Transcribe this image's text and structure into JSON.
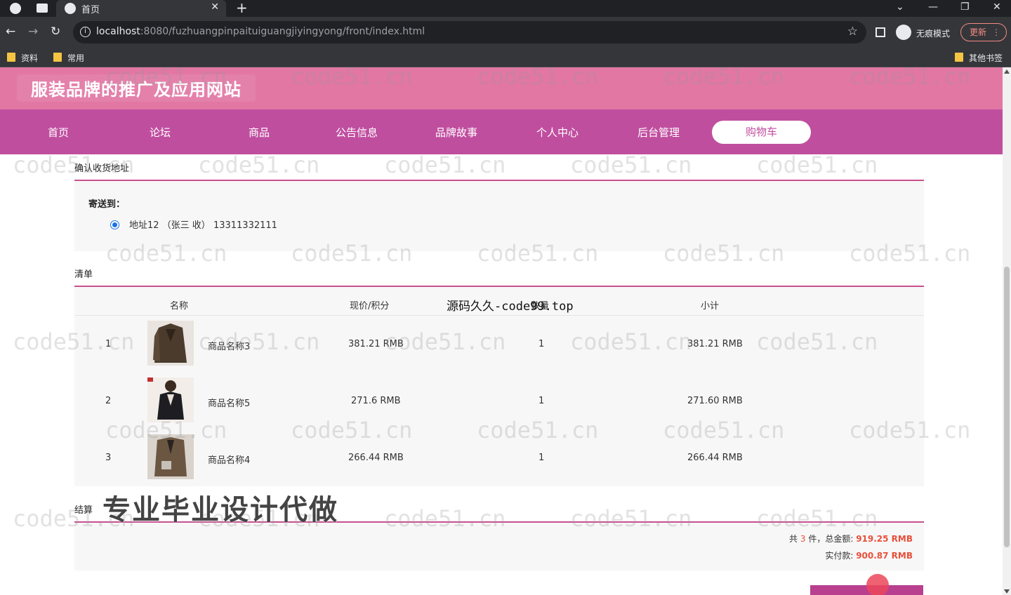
{
  "browser": {
    "tab_title": "首页",
    "url_host": "localhost",
    "url_rest": ":8080/fuzhuangpinpaituiguangjiyingyong/front/index.html",
    "incognito_label": "无痕模式",
    "update_label": "更新",
    "bookmarks": [
      "资料",
      "常用"
    ],
    "other_bookmarks": "其他书签"
  },
  "site": {
    "title": "服装品牌的推广及应用网站",
    "nav": [
      "首页",
      "论坛",
      "商品",
      "公告信息",
      "品牌故事",
      "个人中心",
      "后台管理",
      "购物车"
    ],
    "active_nav": "购物车"
  },
  "address_section": {
    "title": "确认收货地址",
    "ship_to_label": "寄送到：",
    "address": "地址12 （张三 收） 13311332111"
  },
  "list_section": {
    "title": "清单",
    "columns": [
      "名称",
      "现价/积分",
      "数量",
      "小计"
    ],
    "rows": [
      {
        "index": "1",
        "name": "商品名称3",
        "price": "381.21 RMB",
        "qty": "1",
        "subtotal": "381.21 RMB"
      },
      {
        "index": "2",
        "name": "商品名称5",
        "price": "271.6 RMB",
        "qty": "1",
        "subtotal": "271.60 RMB"
      },
      {
        "index": "3",
        "name": "商品名称4",
        "price": "266.44 RMB",
        "qty": "1",
        "subtotal": "266.44 RMB"
      }
    ]
  },
  "settle_section": {
    "title": "结算",
    "count_prefix": "共",
    "count": "3",
    "count_suffix": "件，总金额:",
    "total": "919.25 RMB",
    "paid_label": "实付款:",
    "paid": "900.87 RMB"
  },
  "overlays": {
    "source_text": "源码久久-code99.top",
    "promo_text": "专业毕业设计代做",
    "watermark": "code51.cn"
  }
}
